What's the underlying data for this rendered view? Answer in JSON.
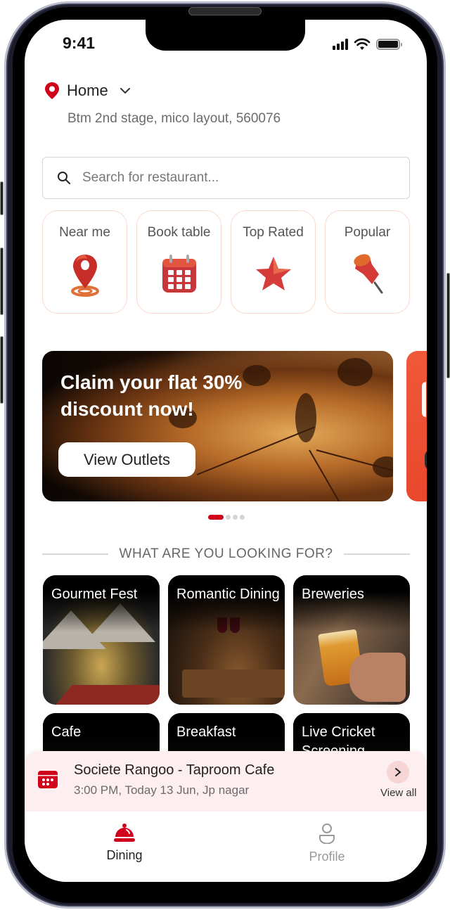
{
  "status_bar": {
    "time": "9:41"
  },
  "location": {
    "title": "Home",
    "address": "Btm 2nd stage, mico layout, 560076"
  },
  "search": {
    "placeholder": "Search for restaurant...",
    "value": ""
  },
  "quick_categories": [
    {
      "label": "Near me",
      "icon": "location-pin-icon"
    },
    {
      "label": "Book table",
      "icon": "calendar-icon"
    },
    {
      "label": "Top Rated",
      "icon": "star-icon"
    },
    {
      "label": "Popular",
      "icon": "pushpin-icon"
    }
  ],
  "banner": {
    "title": "Claim your flat 30% discount now!",
    "button_label": "View Outlets",
    "active_slide": 1,
    "total_slides": 4
  },
  "section": {
    "title": "WHAT ARE YOU LOOKING FOR?"
  },
  "tiles": [
    {
      "label": "Gourmet Fest"
    },
    {
      "label": "Romantic Dining"
    },
    {
      "label": "Breweries"
    },
    {
      "label": "Cafe"
    },
    {
      "label": "Breakfast"
    },
    {
      "label": "Live Cricket Screening"
    }
  ],
  "booking": {
    "title": "Societe Rangoo - Taproom Cafe",
    "subtitle": "3:00 PM, Today 13 Jun, Jp nagar",
    "view_all": "View all"
  },
  "bottom_nav": [
    {
      "label": "Dining",
      "active": true
    },
    {
      "label": "Profile",
      "active": false
    }
  ],
  "colors": {
    "accent": "#d0021b",
    "booking_bg": "#fdeef0",
    "card_border": "#fbd8cc"
  }
}
